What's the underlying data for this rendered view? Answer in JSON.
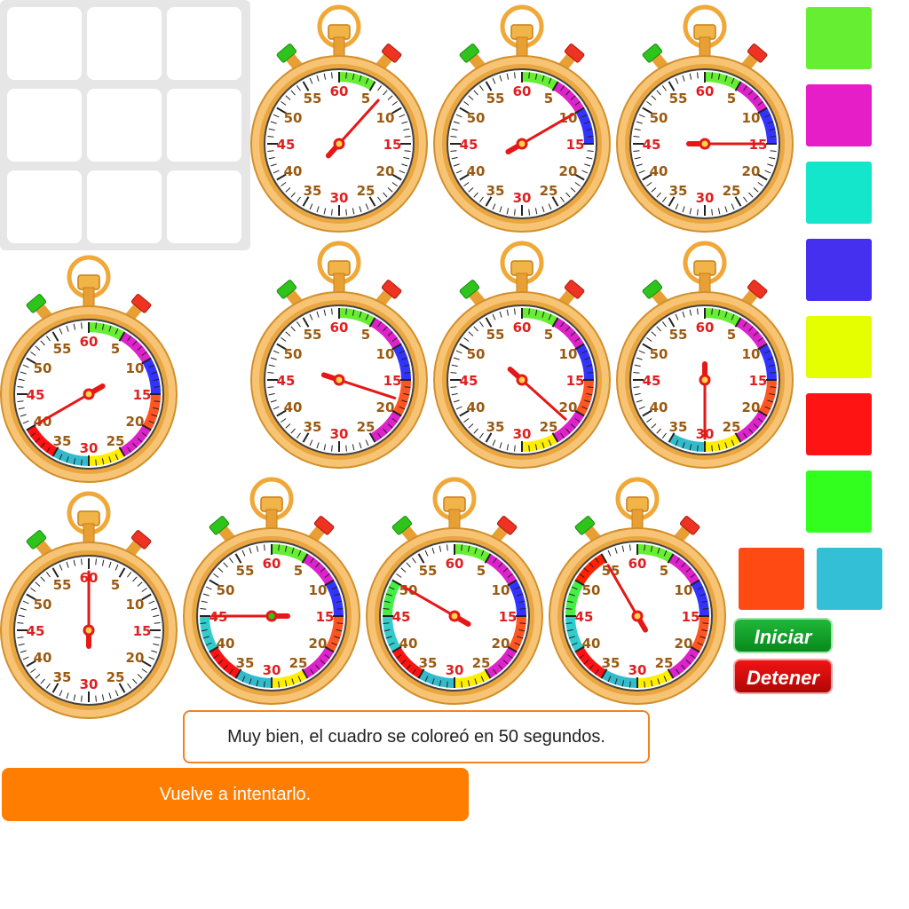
{
  "grid": {
    "rows": 3,
    "cols": 3
  },
  "stopwatches": [
    {
      "seconds": 7,
      "progress_colors": [
        "#66ee33"
      ]
    },
    {
      "seconds": 10,
      "progress_colors": [
        "#66ee33",
        "#dd22cc",
        "#3333ff"
      ]
    },
    {
      "seconds": 15,
      "progress_colors": [
        "#66ee33",
        "#dd22cc",
        "#3333ff"
      ]
    },
    {
      "seconds": 40,
      "progress_colors": [
        "#66ee33",
        "#dd22cc",
        "#3333ff",
        "#ff5522",
        "#dd22cc",
        "#ffee00",
        "#33bbcc",
        "#ff1111"
      ]
    },
    {
      "seconds": 18,
      "progress_colors": [
        "#66ee33",
        "#dd22cc",
        "#3333ff",
        "#ff5522",
        "#dd22cc"
      ]
    },
    {
      "seconds": 22,
      "progress_colors": [
        "#66ee33",
        "#dd22cc",
        "#3333ff",
        "#ff5522",
        "#dd22cc",
        "#ffee00"
      ]
    },
    {
      "seconds": 30,
      "progress_colors": [
        "#66ee33",
        "#dd22cc",
        "#3333ff",
        "#ff5522",
        "#dd22cc",
        "#ffee00",
        "#33bbcc"
      ]
    },
    {
      "seconds": 0,
      "progress_colors": []
    },
    {
      "seconds": 45,
      "progress_colors": [
        "#66ee33",
        "#dd22cc",
        "#3333ff",
        "#ff5522",
        "#dd22cc",
        "#ffee00",
        "#33bbcc",
        "#ff1111",
        "#33cccc"
      ]
    },
    {
      "seconds": 50,
      "progress_colors": [
        "#66ee33",
        "#dd22cc",
        "#3333ff",
        "#ff5522",
        "#dd22cc",
        "#ffee00",
        "#33bbcc",
        "#ff1111",
        "#33cccc",
        "#44ee44"
      ]
    },
    {
      "seconds": 55,
      "progress_colors": [
        "#66ee33",
        "#dd22cc",
        "#3333ff",
        "#ff5522",
        "#dd22cc",
        "#ffee00",
        "#33bbcc",
        "#ff1111",
        "#33cccc",
        "#44ee44",
        "#ff2200"
      ]
    }
  ],
  "dial_numbers": [
    "60",
    "5",
    "10",
    "15",
    "20",
    "25",
    "30",
    "35",
    "40",
    "45",
    "50",
    "55"
  ],
  "palette": [
    "#66ee33",
    "#e61ec8",
    "#14e6cc",
    "#4630f0",
    "#e6ff00",
    "#ff1414",
    "#33ff1e",
    "#ff4a14",
    "#33c0d6"
  ],
  "buttons": {
    "start": "Iniciar",
    "stop": "Detener"
  },
  "message": "Muy bien, el cuadro se coloreó en 50 segundos.",
  "retry": "Vuelve a intentarlo."
}
